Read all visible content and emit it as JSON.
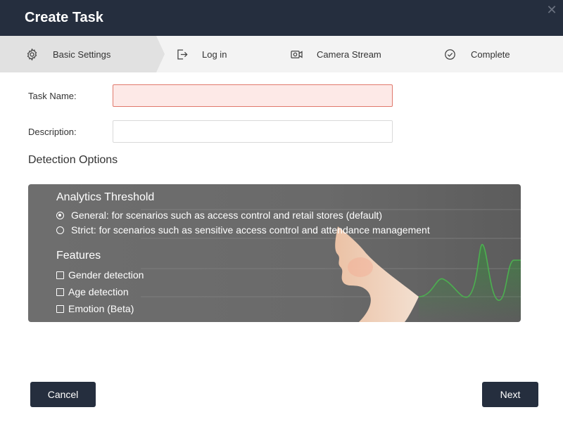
{
  "window": {
    "title": "Create Task",
    "close_icon": "close-icon"
  },
  "steps": [
    {
      "label": "Basic Settings",
      "icon": "gear-icon",
      "active": true
    },
    {
      "label": "Log in",
      "icon": "login-icon"
    },
    {
      "label": "Camera Stream",
      "icon": "camera-icon"
    },
    {
      "label": "Complete",
      "icon": "check-circle-icon"
    }
  ],
  "form": {
    "task_name_label": "Task Name:",
    "task_name_value": "",
    "description_label": "Description:",
    "description_value": ""
  },
  "detection": {
    "heading": "Detection Options",
    "threshold_heading": "Analytics Threshold",
    "thresholds": [
      {
        "label": "General: for scenarios such as access control and retail stores (default)",
        "selected": true
      },
      {
        "label": "Strict: for scenarios such as sensitive access control and attendance management",
        "selected": false
      }
    ],
    "features_heading": "Features",
    "features": [
      {
        "label": "Gender detection",
        "checked": false
      },
      {
        "label": "Age detection",
        "checked": false
      },
      {
        "label": "Emotion (Beta)",
        "checked": false
      }
    ]
  },
  "buttons": {
    "cancel": "Cancel",
    "next": "Next"
  },
  "colors": {
    "titlebar": "#252e3e",
    "button": "#252e3e",
    "error_bg": "#fde9e7",
    "error_border": "#e0796c",
    "wave": "#4caf50"
  }
}
